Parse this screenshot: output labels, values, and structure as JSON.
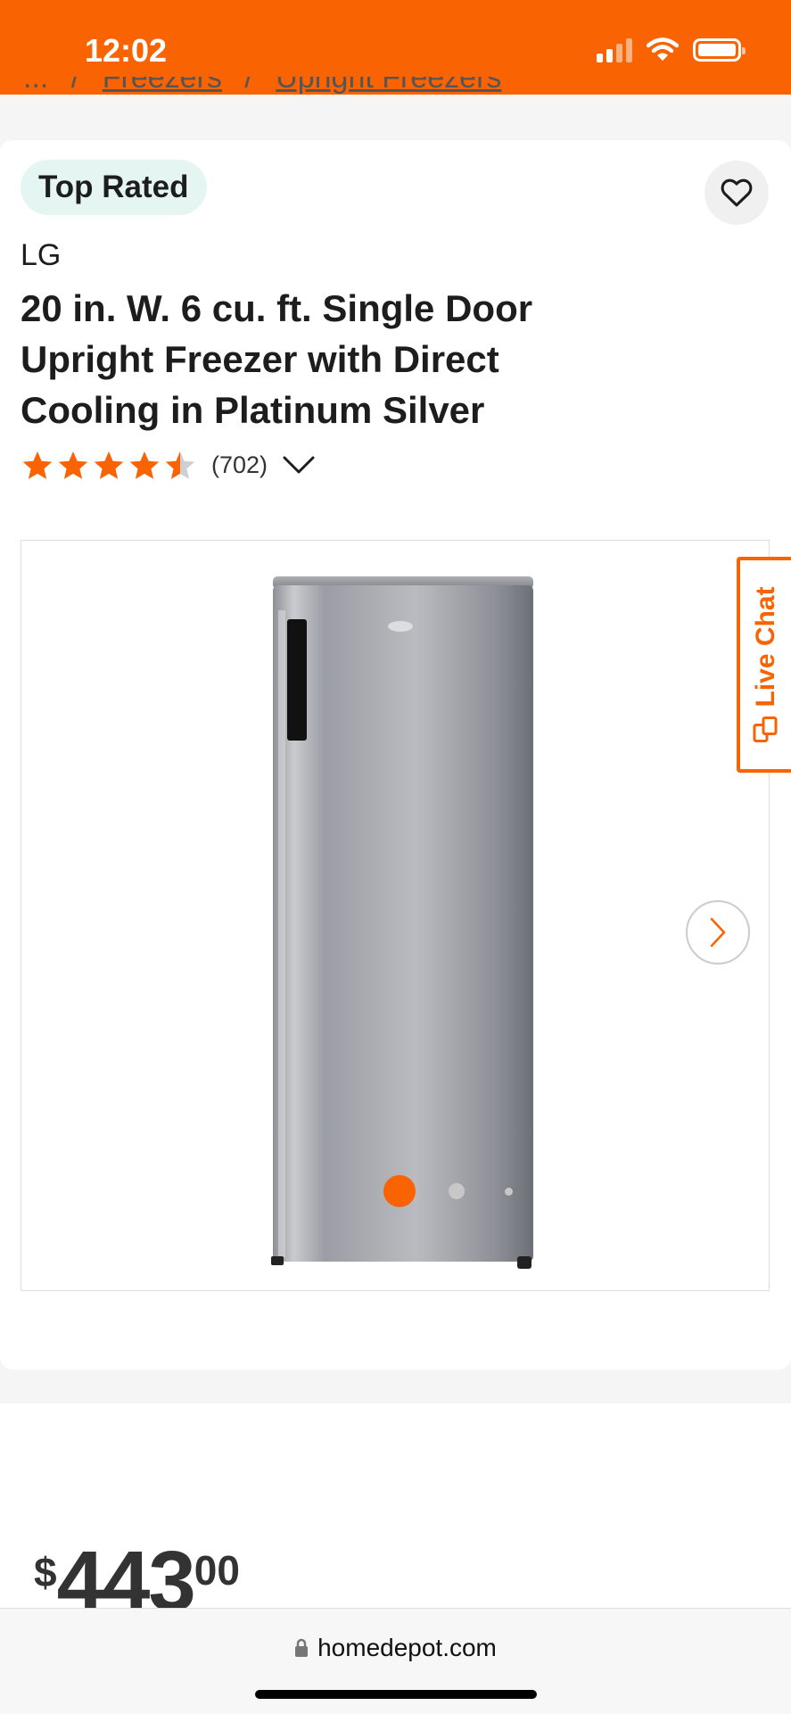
{
  "status": {
    "time": "12:02"
  },
  "breadcrumb": {
    "ellipsis": "...",
    "sep": "/",
    "items": [
      "Freezers",
      "Upright Freezers"
    ]
  },
  "product": {
    "badge": "Top Rated",
    "brand": "LG",
    "title": "20 in. W. 6 cu. ft. Single Door Upright Freezer with Direct Cooling in Platinum Silver",
    "rating": 4.5,
    "review_count": "(702)",
    "image_index": 1,
    "image_count": 3
  },
  "live_chat": {
    "label": "Live Chat"
  },
  "price": {
    "currency": "$",
    "dollars": "443",
    "cents": "00"
  },
  "browser": {
    "url": "homedepot.com"
  },
  "colors": {
    "brand_orange": "#f96302",
    "badge_bg": "#e4f5f2"
  },
  "icons": [
    "signal-icon",
    "wifi-icon",
    "battery-icon",
    "heart-icon",
    "star-icon",
    "chevron-down-icon",
    "chevron-right-icon",
    "chat-icon",
    "lock-icon"
  ]
}
